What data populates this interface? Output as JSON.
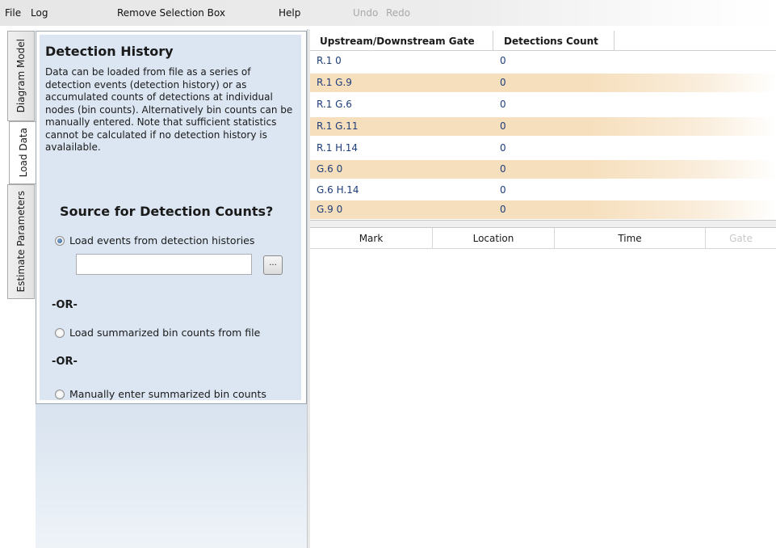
{
  "menu": {
    "file": "File",
    "log": "Log",
    "remove_selection_box": "Remove Selection Box",
    "help": "Help",
    "undo": "Undo",
    "redo": "Redo"
  },
  "tabs": [
    {
      "label": "Diagram Model",
      "active": false
    },
    {
      "label": "Load Data",
      "active": true
    },
    {
      "label": "Estimate Parameters",
      "active": false
    }
  ],
  "panel": {
    "title": "Detection History",
    "description": "Data can be loaded from file as a series of detection events (detection history) or as accumulated counts of detections at individual nodes (bin counts). Alternatively bin counts can be manually entered. Note that sufficient statistics cannot be calculated if no detection history is avalailable.",
    "source_heading": "Source for Detection Counts?",
    "option_histories": "Load events from detection histories",
    "option_selected": "histories",
    "file_path_value": "",
    "browse_label": "...",
    "or_1": "-OR-",
    "option_summarized_file": "Load summarized bin counts from file",
    "or_2": "-OR-",
    "option_manual": "Manually enter summarized bin counts"
  },
  "gate_grid": {
    "headers": [
      "Upstream/Downstream Gate",
      "Detections Count"
    ],
    "rows": [
      {
        "gate": "R.1 0",
        "count": "0"
      },
      {
        "gate": "R.1 G.9",
        "count": "0"
      },
      {
        "gate": "R.1 G.6",
        "count": "0"
      },
      {
        "gate": "R.1 G.11",
        "count": "0"
      },
      {
        "gate": "R.1 H.14",
        "count": "0"
      },
      {
        "gate": "G.6 0",
        "count": "0"
      },
      {
        "gate": "G.6 H.14",
        "count": "0"
      },
      {
        "gate": "G.9 0",
        "count": "0"
      }
    ],
    "alt_row_color": "#f6dfbd",
    "text_color": "#1d3d7a"
  },
  "history_grid": {
    "headers": [
      "Mark",
      "Location",
      "Time",
      "Gate"
    ]
  },
  "colors": {
    "panel_bg": "#dbe6f2",
    "radio_accent": "#2f5c93"
  }
}
